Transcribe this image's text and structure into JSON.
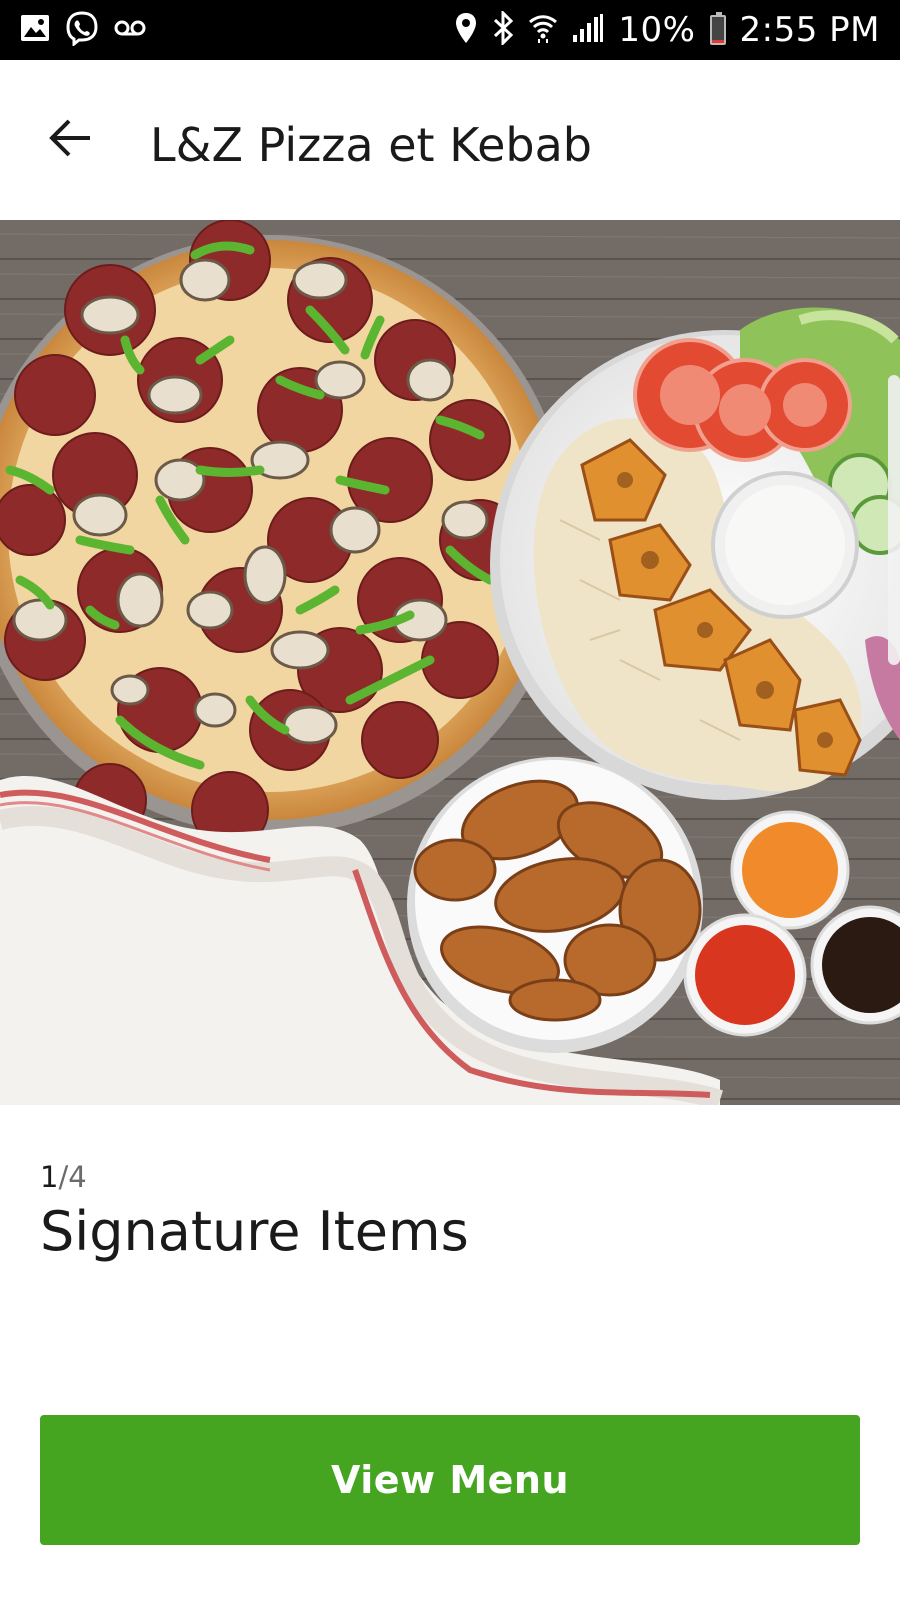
{
  "status_bar": {
    "battery": "10%",
    "time": "2:55 PM",
    "battery_level": 0.1,
    "icons_left": [
      "gallery-icon",
      "viber-icon",
      "voicemail-icon"
    ],
    "icons_right": [
      "location-icon",
      "bluetooth-icon",
      "wifi-icon",
      "signal-icon",
      "battery-icon"
    ]
  },
  "header": {
    "title": "L&Z Pizza et Kebab",
    "back_icon": "arrow-left-icon"
  },
  "carousel": {
    "current": "1",
    "total": "/4",
    "title": "Signature Items"
  },
  "actions": {
    "view_menu_label": "View Menu",
    "button_color": "#45a520"
  }
}
